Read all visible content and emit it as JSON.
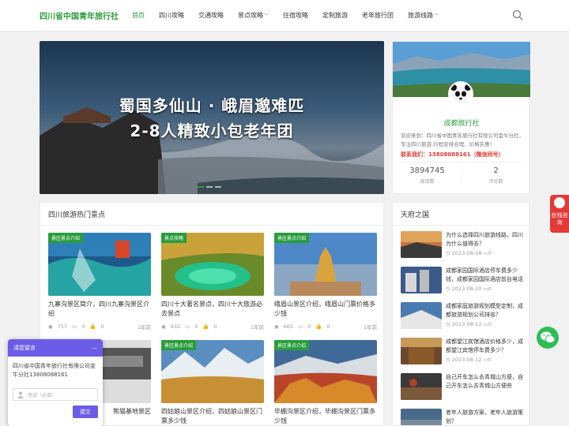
{
  "header": {
    "logo": "四川省中国青年旅行社",
    "nav": [
      {
        "label": "首页",
        "active": true,
        "dropdown": false
      },
      {
        "label": "四川攻略",
        "active": false,
        "dropdown": false
      },
      {
        "label": "交通攻略",
        "active": false,
        "dropdown": false
      },
      {
        "label": "景点攻略",
        "active": false,
        "dropdown": true
      },
      {
        "label": "住宿攻略",
        "active": false,
        "dropdown": false
      },
      {
        "label": "定制旅游",
        "active": false,
        "dropdown": false
      },
      {
        "label": "老年旅行团",
        "active": false,
        "dropdown": false
      },
      {
        "label": "旅游线路",
        "active": false,
        "dropdown": true
      }
    ],
    "search_icon": "search-icon"
  },
  "banner": {
    "line1": "蜀国多仙山 · 峨眉邈难匹",
    "line2": "2-8人精致小包老年团"
  },
  "profile": {
    "name": "成都旅行社",
    "desc": "欢迎来到：四川省中国青年旅行社有限公司金牛分社，专注四川旅游,行程安排合理、价格实惠！",
    "phone": "联系我们：13808088161（微信同号）",
    "reads": "3894745",
    "reads_label": "阅读数",
    "comments": "2",
    "comments_label": "评论数"
  },
  "hot": {
    "title": "四川旅游热门景点",
    "cards": [
      {
        "tag": "景区景点介绍",
        "title": "九寨沟景区简介，四川九寨沟景区介绍",
        "views": "757",
        "comments": "0",
        "likes": "0",
        "time": "1年前"
      },
      {
        "tag": "景点攻略",
        "title": "四川十大著名景点，四川十大旅游必去景点",
        "views": "932",
        "comments": "0",
        "likes": "0",
        "time": "1年前"
      },
      {
        "tag": "景区景点介绍",
        "title": "峨眉山景区介绍，峨眉山门票价格多少钱",
        "views": "665",
        "comments": "0",
        "likes": "0",
        "time": "1年前"
      },
      {
        "tag": "",
        "title": "熊猫基地景区",
        "views": "",
        "comments": "",
        "likes": "",
        "time": ""
      },
      {
        "tag": "景区景点介绍",
        "title": "四姑娘山景区介绍，四姑娘山景区门票多少钱",
        "views": "",
        "comments": "",
        "likes": "",
        "time": ""
      },
      {
        "tag": "景区景点介绍",
        "title": "毕棚沟景区介绍，毕棚沟景区门票多少钱",
        "views": "",
        "comments": "",
        "likes": "",
        "time": ""
      }
    ]
  },
  "side": {
    "title": "天府之国",
    "items": [
      {
        "title": "为什么选择四川旅游线路，四川为什么值得去？",
        "date": "2023-08-08",
        "comments": "0"
      },
      {
        "title": "成都家园国际酒店停车费多少钱，成都家园国际酒店前台电话多少",
        "date": "2023-08-10",
        "comments": "0"
      },
      {
        "title": "成都家庭旅游规划模型定制，成都旅游规划公司排名？",
        "date": "2023-08-12",
        "comments": "0"
      },
      {
        "title": "成都望江宾馆酒店价格多少，成都望江宾馆停车费多少？",
        "date": "2023-08-12",
        "comments": "0"
      },
      {
        "title": "自己开车怎么去青城山方便，自己开车怎么去青城山方便些",
        "date": "",
        "comments": ""
      },
      {
        "title": "老年人旅游方案，老年人旅游策划？",
        "date": "",
        "comments": ""
      }
    ]
  },
  "float": {
    "consult": "在线咨询"
  },
  "chat": {
    "title": "请您留言",
    "close": "—",
    "message": "四川省中国青年旅行社有限公司金牛分社13808088161",
    "phone_placeholder": "电话（必填）",
    "submit": "提交"
  },
  "colors": {
    "brand": "#2a9d3c",
    "alert": "#e53935",
    "chat": "#6c5ce7"
  }
}
